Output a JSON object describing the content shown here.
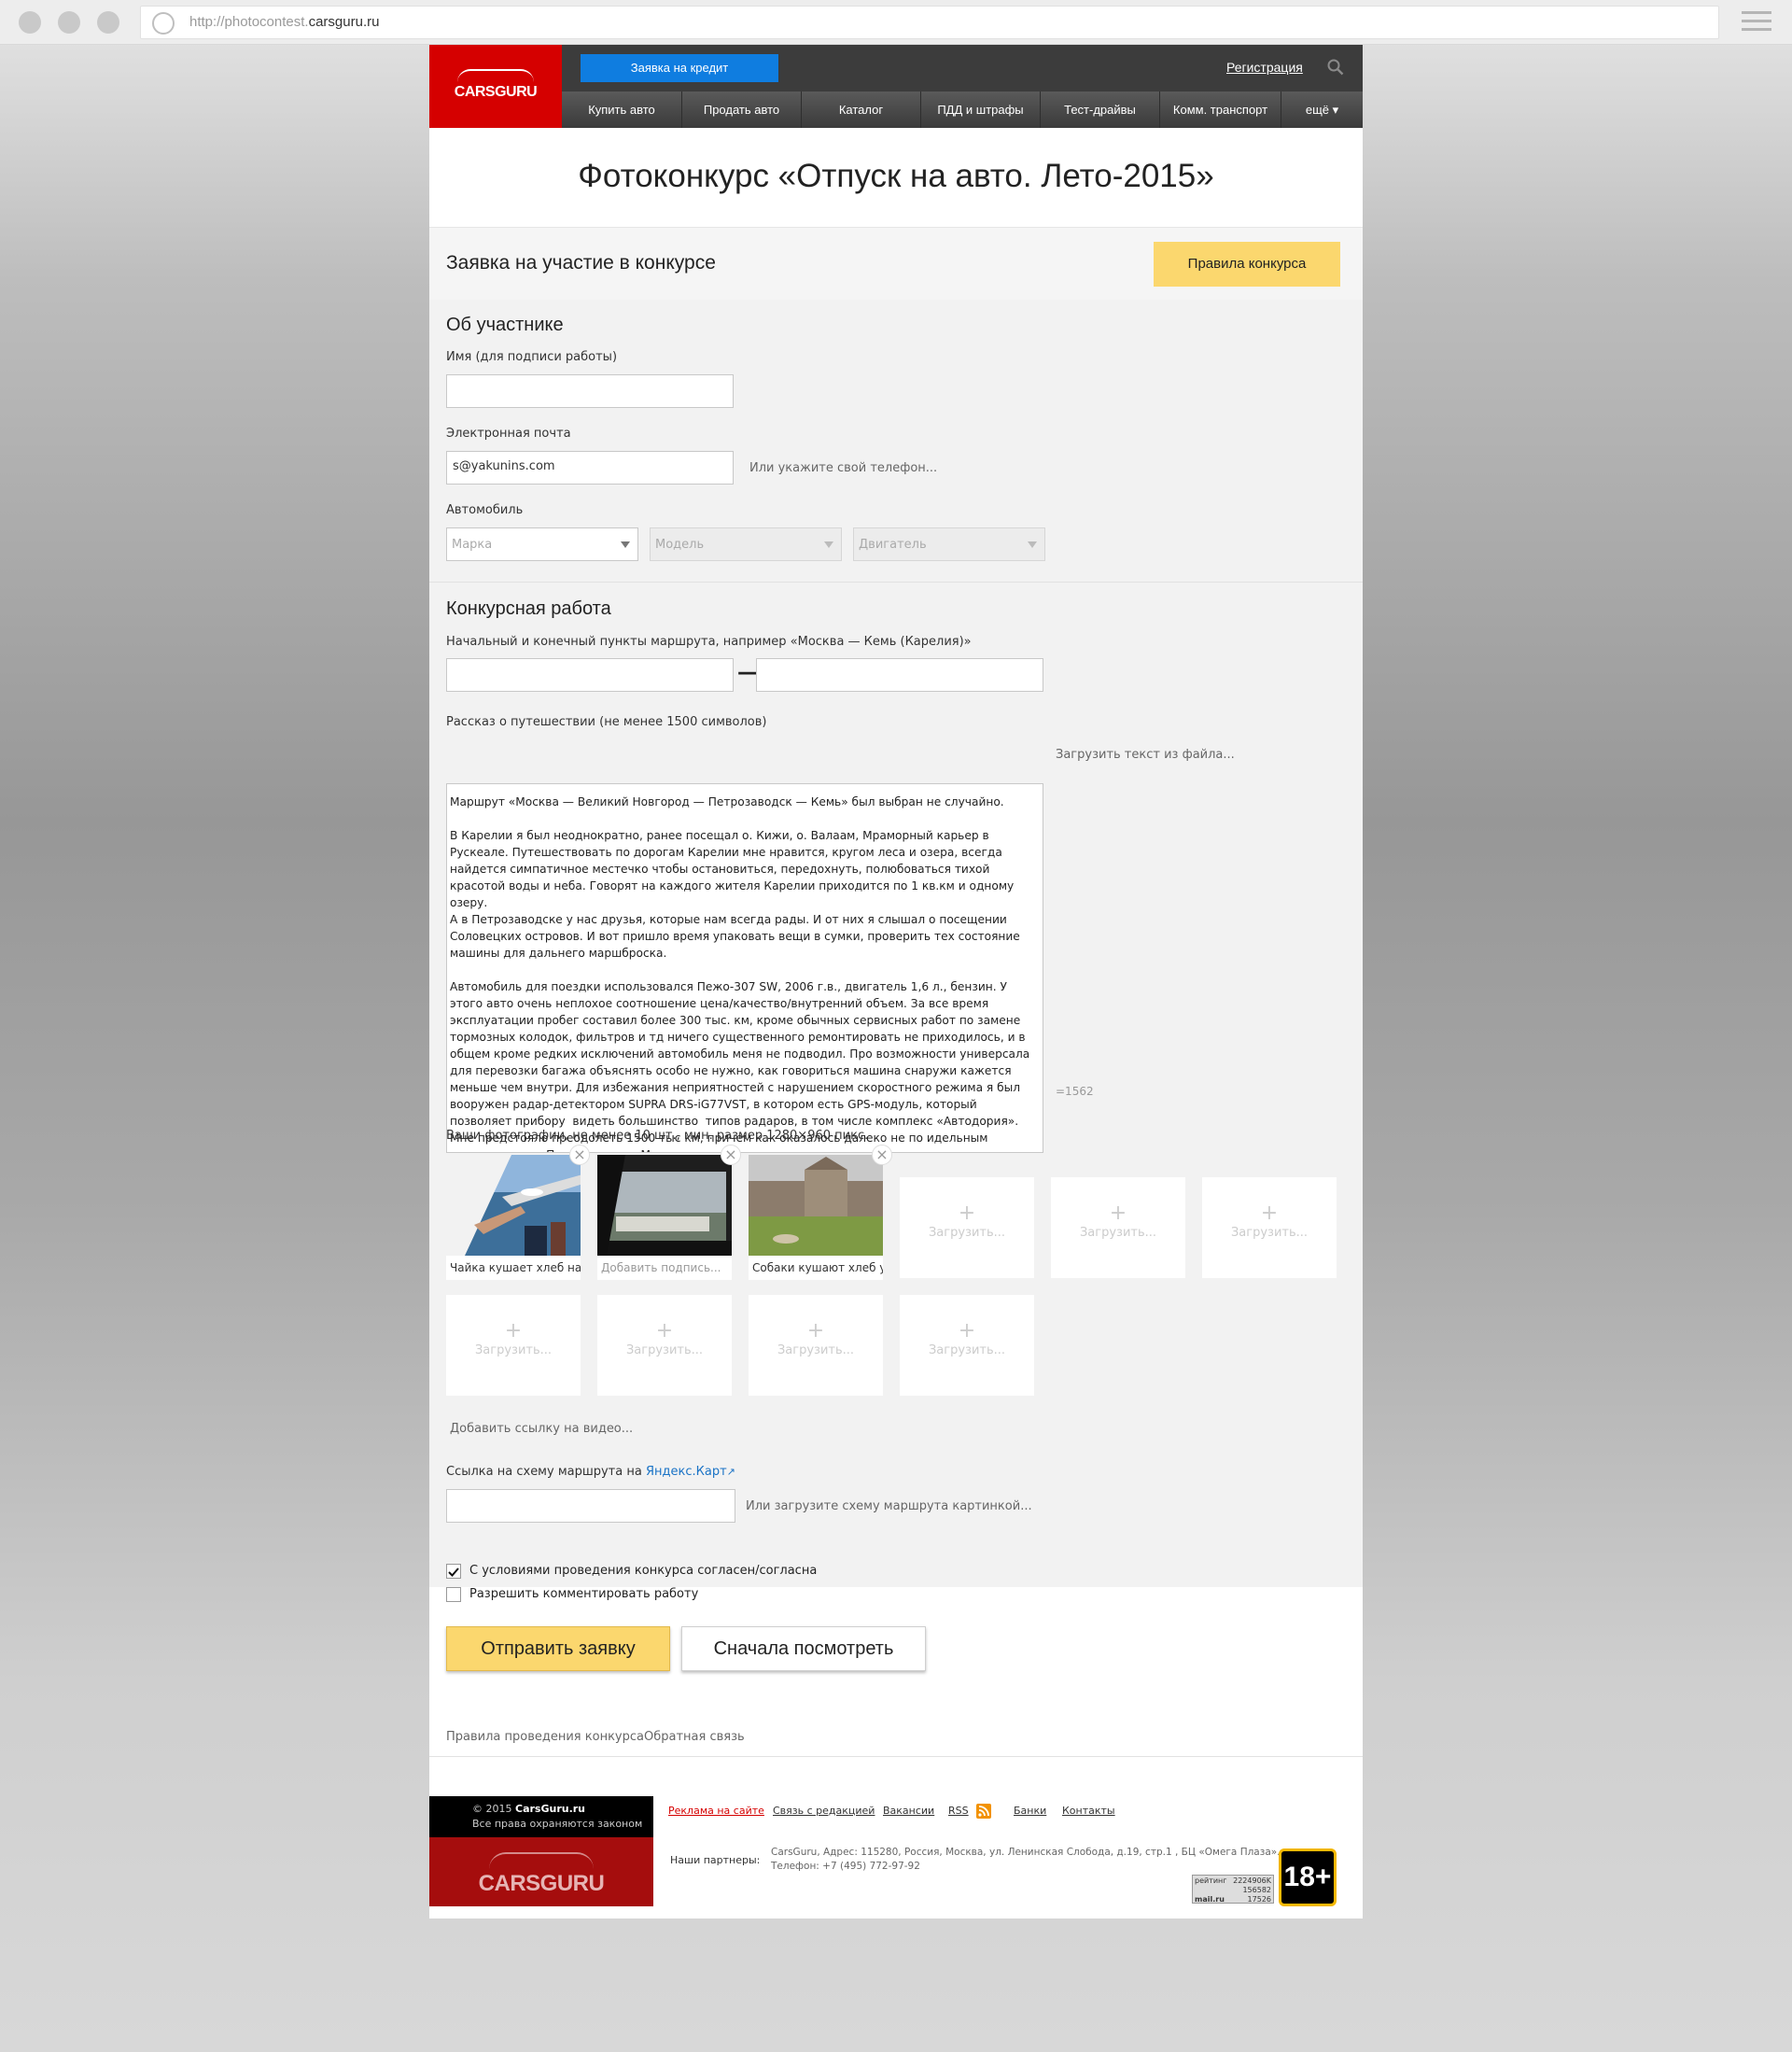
{
  "browser": {
    "url_prefix": "http://photocontest.",
    "url_domain": "carsguru.ru"
  },
  "header": {
    "logo": "CARSGURU",
    "credit_button": "Заявка на кредит",
    "register_link": "Регистрация",
    "nav": [
      "Купить авто",
      "Продать авто",
      "Каталог",
      "ПДД и штрафы",
      "Тест-драйвы",
      "Комм. транспорт",
      "ещё ▾"
    ]
  },
  "page_title": "Фотоконкурс «Отпуск на авто. Лето-2015»",
  "form": {
    "title": "Заявка на участие в конкурсе",
    "rules_button": "Правила конкурса",
    "participant": {
      "heading": "Об участнике",
      "name_label": "Имя (для подписи работы)",
      "name_value": "",
      "email_label": "Электронная почта",
      "email_value": "s@yakunins.com",
      "phone_link": "Или укажите свой телефон...",
      "car_label": "Автомобиль",
      "brand_placeholder": "Марка",
      "model_placeholder": "Модель",
      "engine_placeholder": "Двигатель"
    },
    "work": {
      "heading": "Конкурсная работа",
      "route_label": "Начальный и конечный пункты маршрута, например «Москва — Кемь (Карелия)»",
      "route_separator": "—",
      "story_label": "Рассказ о путешествии (не менее 1500 символов)",
      "upload_text_link": "Загрузить текст из файла...",
      "story_text": "Маршрут «Москва — Великий Новгород — Петрозаводск — Кемь» был выбран не случайно.\n\nВ Карелии я был неоднократно, ранее посещал о. Кижи, о. Валаам, Мраморный карьер в Рускеале. Путешествовать по дорогам Карелии мне нравится, кругом леса и озера, всегда найдется симпатичное местечко чтобы остановиться, передохнуть, полюбоваться тихой красотой воды и неба. Говорят на каждого жителя Карелии приходится по 1 кв.км и одному озеру.\nА в Петрозаводске у нас друзья, которые нам всегда рады. И от них я слышал о посещении Соловецких островов. И вот пришло время упаковать вещи в сумки, проверить тех состояние машины для дальнего маршброска.\n\nАвтомобиль для поездки использовался Пежо-307 SW, 2006 г.в., двигатель 1,6 л., бензин. У этого авто очень неплохое соотношение цена/качество/внутренний объем. За все время эксплуатации пробег составил более 300 тыс. км, кроме обычных сервисных работ по замене тормозных колодок, фильтров и тд ничего существенного ремонтировать не приходилось, и в общем кроме редких исключений автомобиль меня не подводил. Про возможности универсала для перевозки багажа объяснять особо не нужно, как говориться машина снаружи кажется меньше чем внутри. Для избежания неприятностей с нарушением скоростного режима я был вооружен радар-детектором SUPRA DRS-iG77VST, в котором есть GPS-модуль, который позволяет прибору  видеть большинство  типов радаров, в том числе комплекс «Автодория». Мне предстояло преодолеть 1500 тыс км, причем как оказалось далеко не по идельным дорогам, после Петрозаводска Мурманская трасса местами ремонтируется, но есть участки как стиральная доска...",
      "char_count": "=1562",
      "photos_label": "Ваши фотографии, не менее 10 шт., мин. размер 1280×960 пикс.",
      "photos": [
        {
          "caption": "Чайка кушает хлеб на..."
        },
        {
          "caption": "Добавить подпись..."
        },
        {
          "caption": "Собаки кушают хлеб у..."
        }
      ],
      "upload_slot_label": "Загрузить...",
      "upload_plus": "+",
      "close_glyph": "×",
      "video_link": "Добавить ссылку на видео...",
      "map_label": "Ссылка на схему маршрута на",
      "map_link": "Яндекс.Карт",
      "map_link_icon": "↗",
      "map_upload_link": "Или загрузите схему маршрута картинкой..."
    },
    "agree_label": "С условиями проведения конкурса согласен/согласна",
    "agree_checked": true,
    "allow_comments_label": "Разрешить комментировать работу",
    "allow_comments_checked": false,
    "submit_button": "Отправить заявку",
    "preview_button": "Сначала посмотреть",
    "rules_link": "Правила проведения конкурса",
    "feedback_link": "Обратная связь"
  },
  "footer": {
    "copyright_year": "© 2015",
    "copyright_site": "CarsGuru.ru",
    "rights": "Все права охраняются законом",
    "logo": "CARSGURU",
    "nav": [
      "Реклама на сайте",
      "Связь с редакцией",
      "Вакансии",
      "RSS",
      "Банки",
      "Контакты"
    ],
    "partners_label": "Наши партнеры:",
    "address_line1": "CarsGuru, Адрес: 115280, Россия, Москва, ул. Ленинская Слобода, д.19, стр.1 , БЦ «Омега Плаза».",
    "address_line2": "Телефон: +7 (495) 772-97-92",
    "counter_brand": "mail.ru",
    "counter_label": "рейтинг",
    "counter_values": [
      "2224906K",
      "156582",
      "17526"
    ],
    "age_badge": "18+"
  },
  "colors": {
    "brand_red": "#d50000",
    "accent_yellow": "#fbd76e",
    "credit_blue": "#0f7de0",
    "link_blue": "#1a73c6"
  }
}
